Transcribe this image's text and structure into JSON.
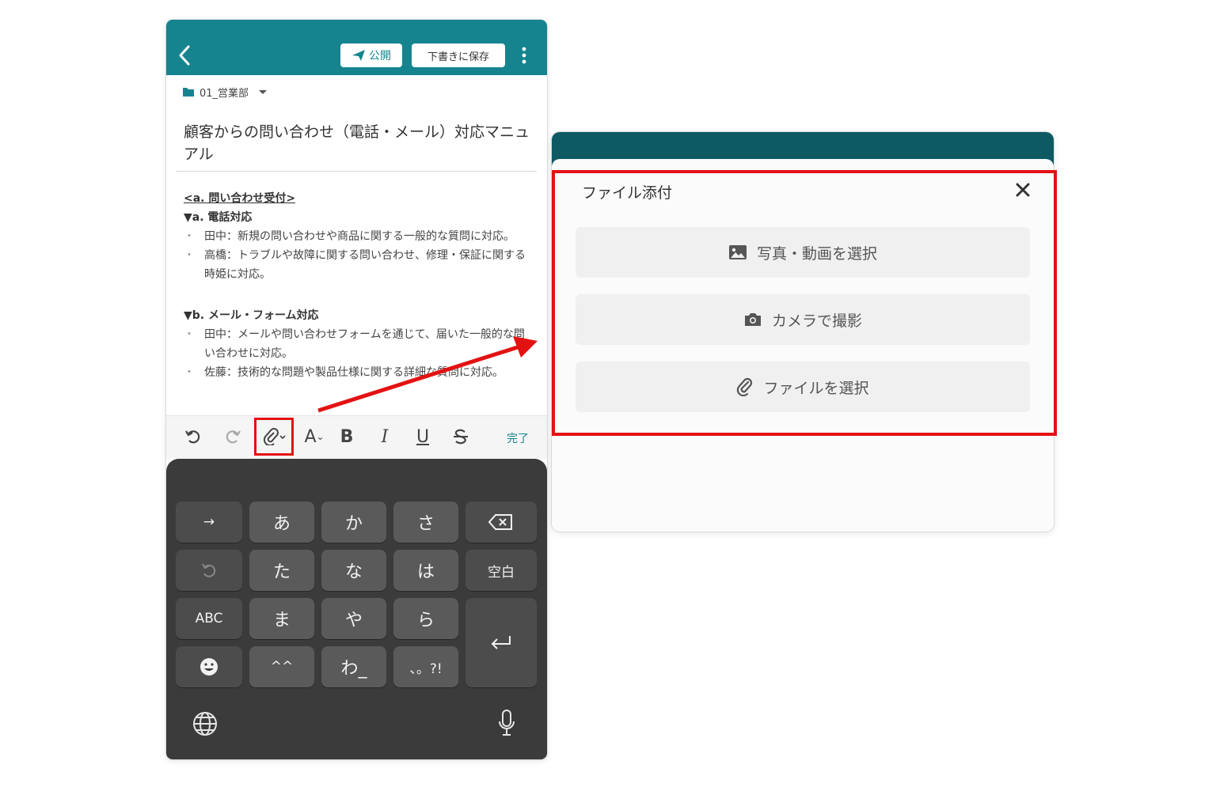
{
  "header": {
    "publish_label": "公開",
    "draft_label": "下書きに保存"
  },
  "folder": {
    "name": "01_営業部"
  },
  "document": {
    "title": "顧客からの問い合わせ（電話・メール）対応マニュアル",
    "section_heading": "<a. 問い合わせ受付>",
    "phone_heading": "▼a. 電話対応",
    "phone_items": [
      "田中：新規の問い合わせや商品に関する一般的な質問に対応。",
      "高橋：トラブルや故障に関する問い合わせ、修理・保証に関する時姫に対応。"
    ],
    "mail_heading": "▼b. メール・フォーム対応",
    "mail_items": [
      "田中：メールや問い合わせフォームを通じて、届いた一般的な問い合わせに対応。",
      "佐藤：技術的な問題や製品仕様に関する詳細な質問に対応。"
    ]
  },
  "toolbar": {
    "done_label": "完了",
    "icons": [
      "undo-icon",
      "redo-icon",
      "attach-icon",
      "font-size-icon",
      "bold-icon",
      "italic-icon",
      "underline-icon",
      "strikethrough-icon"
    ],
    "bold": "B",
    "italic": "I",
    "underline": "U",
    "font_size": "A"
  },
  "keyboard": {
    "row1": [
      "→",
      "あ",
      "か",
      "さ"
    ],
    "row2": [
      "た",
      "な",
      "は",
      "空白"
    ],
    "row3": [
      "ABC",
      "ま",
      "や",
      "ら"
    ],
    "row4": [
      "^^",
      "わ_",
      "、。?!"
    ],
    "icons": [
      "backspace-icon",
      "undo-key-icon",
      "emoji-icon",
      "return-icon",
      "globe-icon",
      "microphone-icon"
    ]
  },
  "dialog": {
    "title": "ファイル添付",
    "options": [
      {
        "label": "写真・動画を選択",
        "icon": "image-icon"
      },
      {
        "label": "カメラで撮影",
        "icon": "camera-icon"
      },
      {
        "label": "ファイルを選択",
        "icon": "paperclip-icon"
      }
    ]
  },
  "colors": {
    "header_teal": "#16848f",
    "dialog_backdrop": "#0d5a63",
    "highlight_red": "#e31212",
    "keyboard_bg": "#3b3b3b"
  }
}
